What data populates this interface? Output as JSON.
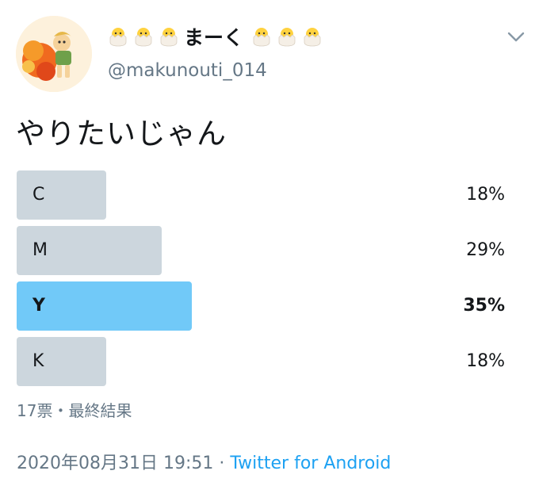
{
  "user": {
    "name": "まーく",
    "name_emoji_left": "🐣🐣🐣",
    "name_emoji_right": "🐣🐣🐣",
    "handle": "@makunouti_014"
  },
  "tweet": {
    "text": "やりたいじゃん"
  },
  "poll": {
    "options": [
      {
        "label": "C",
        "percent_text": "18%",
        "percent": 18,
        "leading": false
      },
      {
        "label": "M",
        "percent_text": "29%",
        "percent": 29,
        "leading": false
      },
      {
        "label": "Y",
        "percent_text": "35%",
        "percent": 35,
        "leading": true
      },
      {
        "label": "K",
        "percent_text": "18%",
        "percent": 18,
        "leading": false
      }
    ],
    "meta": "17票・最終結果"
  },
  "footer": {
    "timestamp": "2020年08月31日 19:51",
    "separator": " · ",
    "source": "Twitter for Android"
  },
  "colors": {
    "bar": "#ccd6dd",
    "bar_leading": "#71c9f8",
    "link": "#1da1f2",
    "muted": "#657786"
  },
  "icons": {
    "caret": "chevron-down-icon",
    "avatar": "avatar"
  }
}
